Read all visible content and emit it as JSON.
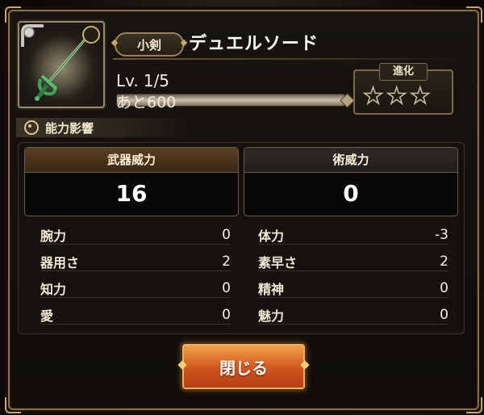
{
  "weapon": {
    "category": "小剣",
    "name": "デュエルソード",
    "icon": "rapier-icon"
  },
  "level": {
    "prefix": "Lv.",
    "value": "1/5",
    "remaining": "あと600"
  },
  "evolution": {
    "label": "進化",
    "stars_total": 3,
    "stars_filled": 0
  },
  "section": {
    "title": "能力影響"
  },
  "power": {
    "weapon_label": "武器威力",
    "weapon_value": "16",
    "art_label": "術威力",
    "art_value": "0"
  },
  "stats_left": [
    {
      "label": "腕力",
      "value": "0"
    },
    {
      "label": "器用さ",
      "value": "2"
    },
    {
      "label": "知力",
      "value": "0"
    },
    {
      "label": "愛",
      "value": "0"
    }
  ],
  "stats_right": [
    {
      "label": "体力",
      "value": "-3"
    },
    {
      "label": "素早さ",
      "value": "2"
    },
    {
      "label": "精神",
      "value": "0"
    },
    {
      "label": "魅力",
      "value": "0"
    }
  ],
  "buttons": {
    "close_label": "閉じる"
  },
  "colors": {
    "frame_gold": "#8a7044",
    "button_orange": "#d0561d",
    "weapon_green": "#3aa65a"
  }
}
